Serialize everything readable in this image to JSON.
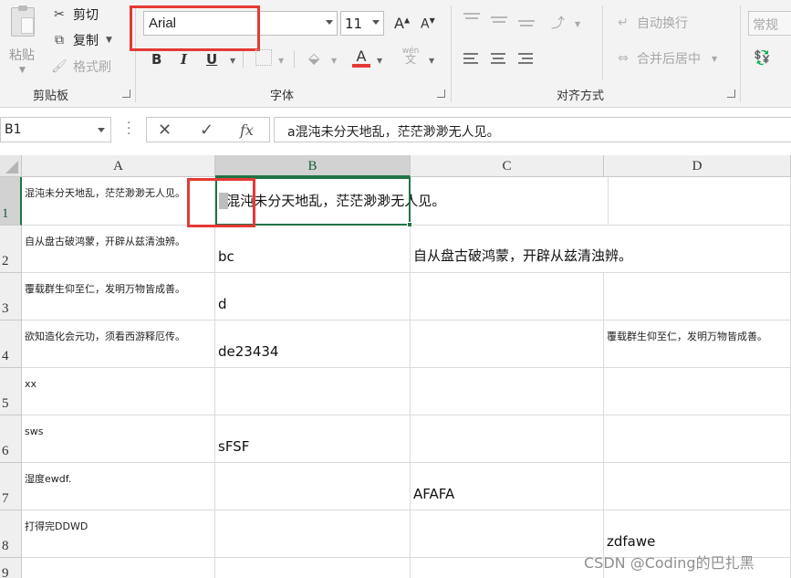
{
  "ribbon": {
    "clipboard": {
      "group_label": "剪贴板",
      "paste_label": "粘贴",
      "cut_label": "剪切",
      "copy_label": "复制",
      "format_painter_label": "格式刷"
    },
    "font": {
      "group_label": "字体",
      "font_name": "Arial",
      "font_size": "11",
      "grow_font": "A",
      "shrink_font": "A",
      "bold": "B",
      "italic": "I",
      "underline": "U",
      "font_color_glyph": "A",
      "font_color": "#e53935",
      "phonetic_label": "wén"
    },
    "alignment": {
      "group_label": "对齐方式",
      "wrap_text_label": "自动换行",
      "merge_center_label": "合并后居中"
    },
    "number": {
      "format_value": "常规"
    }
  },
  "formula_bar": {
    "name_box": "B1",
    "cancel_glyph": "✕",
    "enter_glyph": "✓",
    "fx_glyph": "fx",
    "content": "a混沌未分天地乱，茫茫渺渺无人见。"
  },
  "sheet": {
    "columns": [
      "A",
      "B",
      "C",
      "D"
    ],
    "rows": [
      "1",
      "2",
      "3",
      "4",
      "5",
      "6",
      "7",
      "8",
      "9"
    ],
    "cells": {
      "A1": "混沌未分天地乱，茫茫渺渺无人见。",
      "B1": "a混沌未分天地乱，茫茫渺渺无人见。",
      "A2": "自从盘古破鸿蒙，开辟从兹清浊辨。",
      "B2": "bc",
      "C2": "自从盘古破鸿蒙，开辟从兹清浊辨。",
      "A3": "覆载群生仰至仁，发明万物皆成善。",
      "B3": "d",
      "A4": "欲知造化会元功，须看西游释厄传。",
      "B4": "de23434",
      "D4": "覆载群生仰至仁，发明万物皆成善。",
      "A5": "xx",
      "A6": "sws",
      "B6": "sFSF",
      "A7": "湿度ewdf.",
      "C7": "AFAFA",
      "A8": "打得完DDWD",
      "D8": "zdfawe"
    }
  },
  "watermark": "CSDN @Coding的巴扎黑",
  "colors": {
    "accent_green": "#217346",
    "highlight_red": "#e53935"
  }
}
